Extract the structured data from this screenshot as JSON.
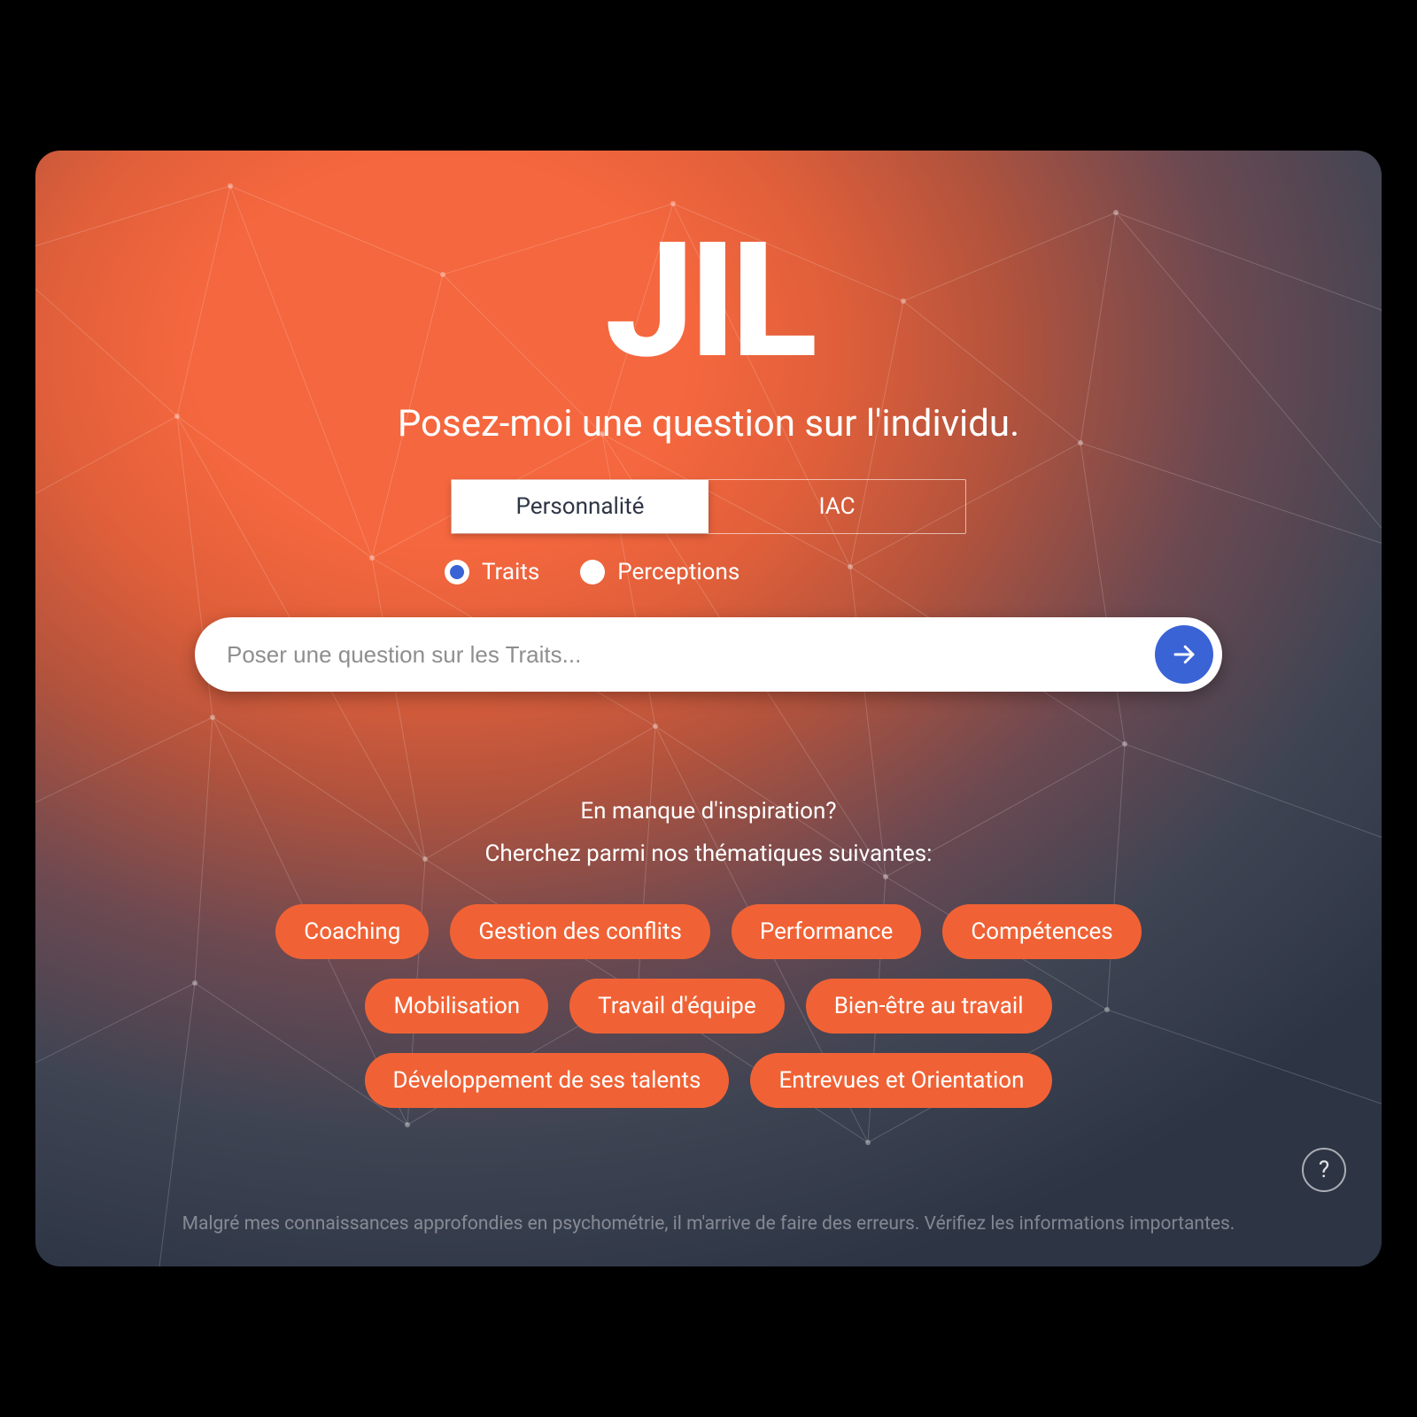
{
  "logo": "JIL",
  "subtitle": "Posez-moi une question sur l'individu.",
  "tabs": {
    "personality": "Personnalité",
    "iac": "IAC"
  },
  "radios": {
    "traits": "Traits",
    "perceptions": "Perceptions"
  },
  "search": {
    "placeholder": "Poser une question sur les Traits..."
  },
  "inspiration": {
    "line1": "En manque d'inspiration?",
    "line2": "Cherchez parmi nos thématiques suivantes:"
  },
  "chips": [
    "Coaching",
    "Gestion des conflits",
    "Performance",
    "Compétences",
    "Mobilisation",
    "Travail d'équipe",
    "Bien-être au travail",
    "Développement de ses talents",
    "Entrevues et Orientation"
  ],
  "help": "?",
  "disclaimer": "Malgré mes connaissances approfondies en psychométrie, il m'arrive de faire des erreurs. Vérifiez les informations importantes.",
  "colors": {
    "accent_orange": "#f06235",
    "accent_blue": "#3a63d6"
  }
}
